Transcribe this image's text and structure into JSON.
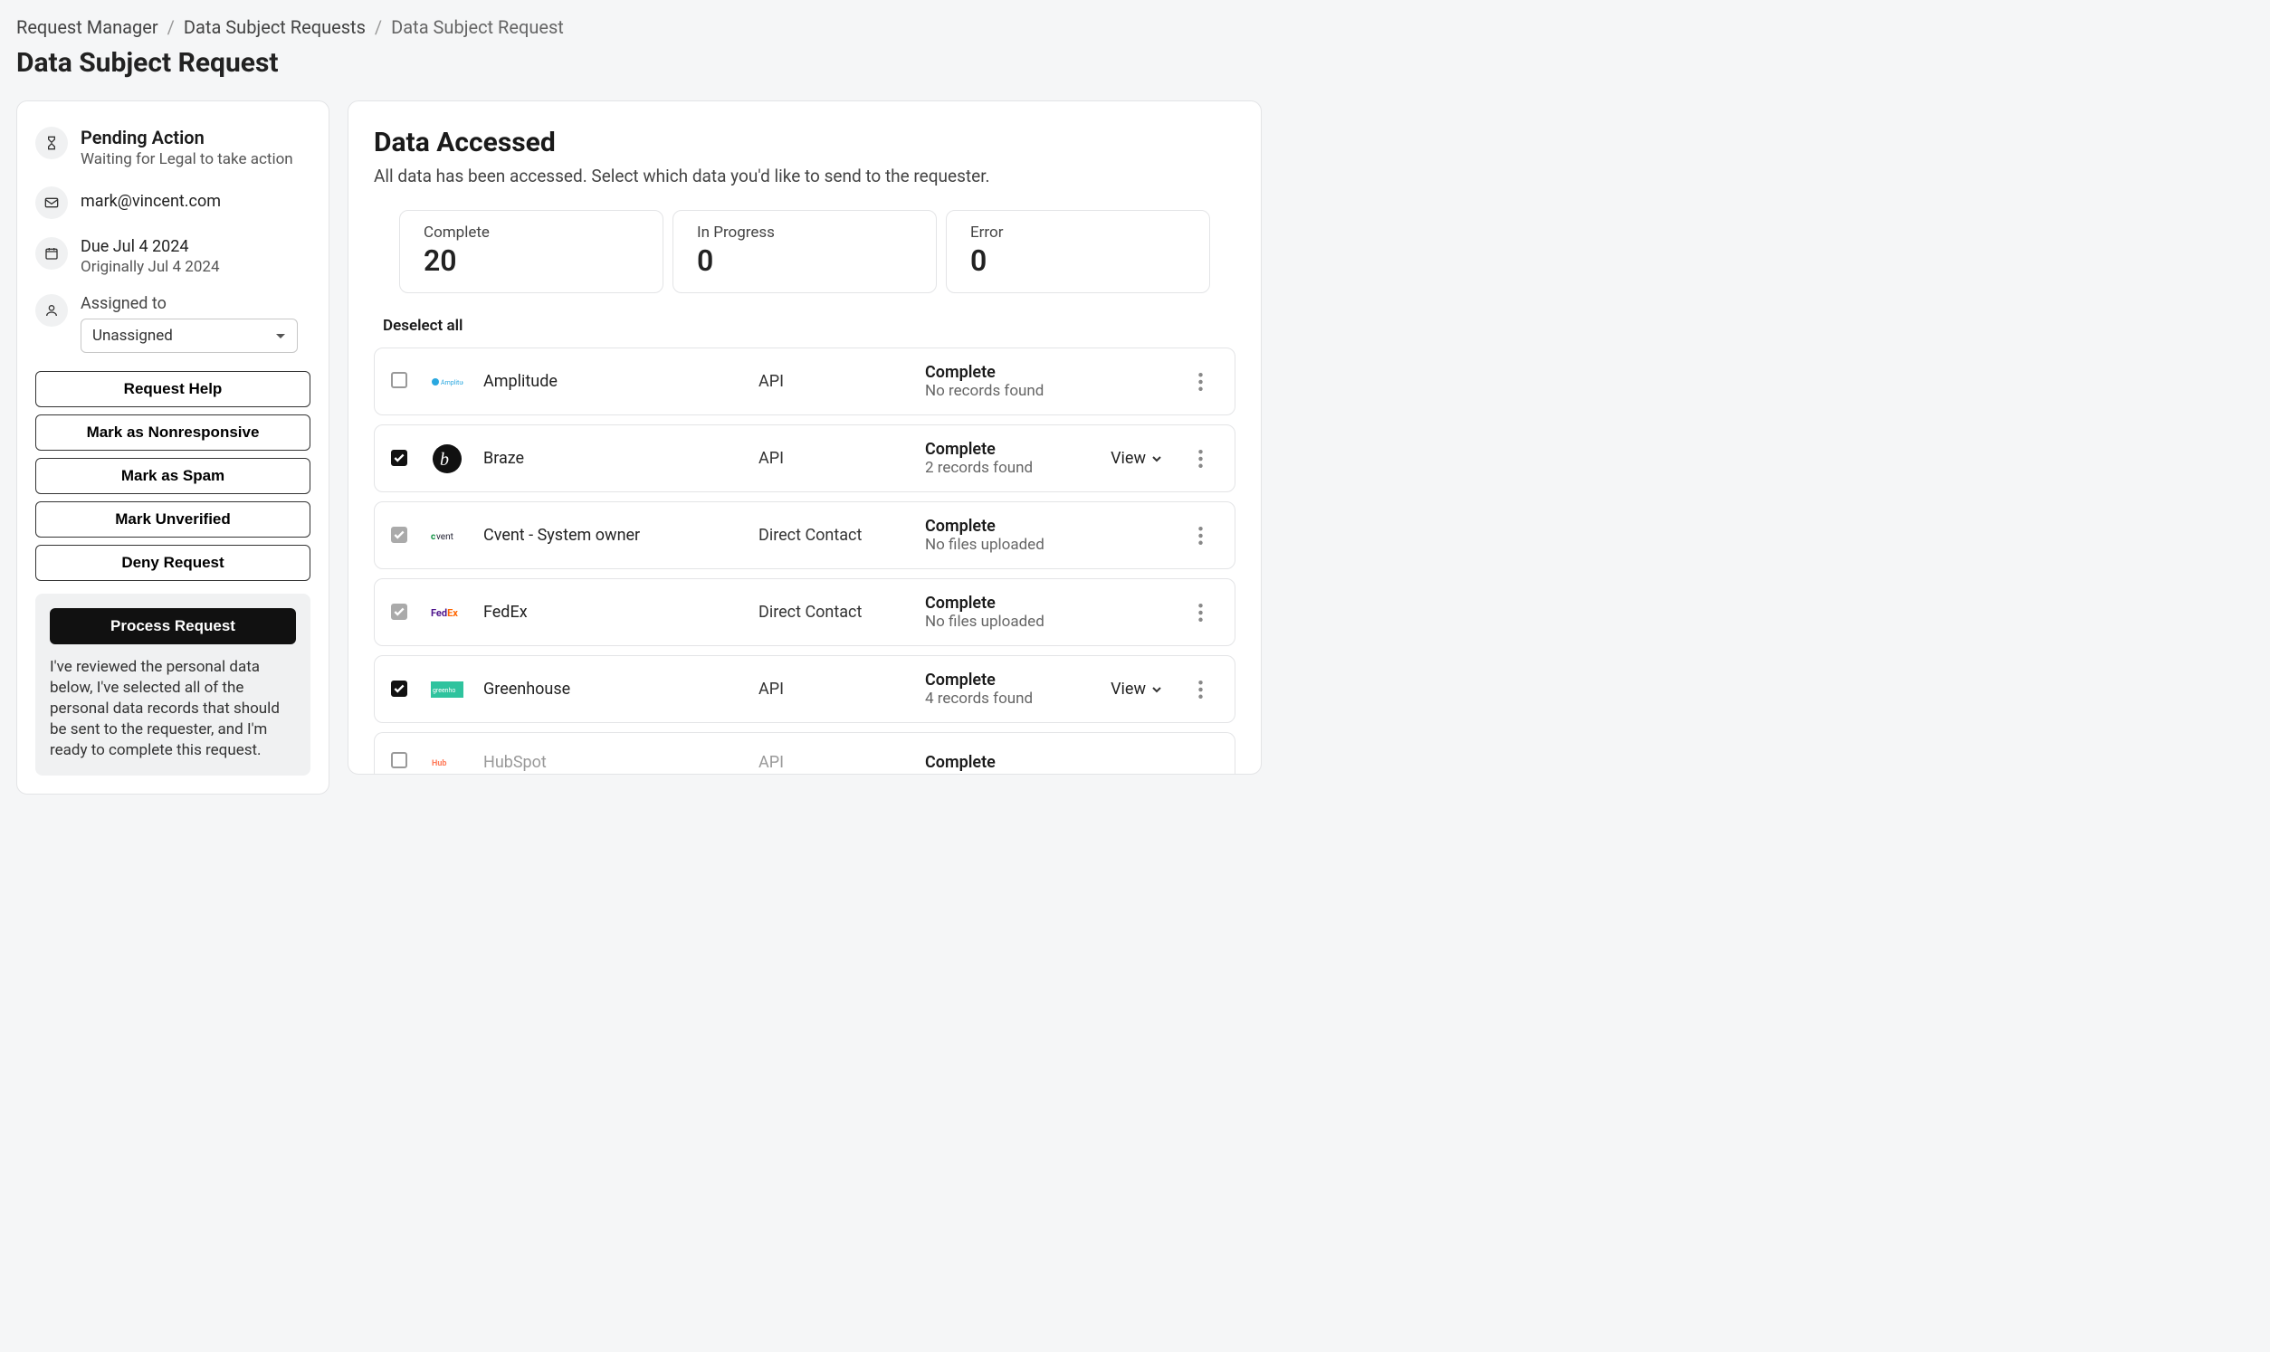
{
  "breadcrumb": [
    "Request Manager",
    "Data Subject Requests",
    "Data Subject Request"
  ],
  "page_title": "Data Subject Request",
  "sidebar": {
    "status_title": "Pending Action",
    "status_sub": "Waiting for Legal to take action",
    "email": "mark@vincent.com",
    "due": "Due Jul 4 2024",
    "original": "Originally Jul 4 2024",
    "assigned_label": "Assigned to",
    "assigned_value": "Unassigned",
    "buttons": {
      "help": "Request Help",
      "nonresponsive": "Mark as Nonresponsive",
      "spam": "Mark as Spam",
      "unverified": "Mark Unverified",
      "deny": "Deny Request"
    },
    "process_btn": "Process Request",
    "process_text": "I've reviewed the personal data below, I've selected all of the personal data records that should be sent to the requester, and I'm ready to complete this request."
  },
  "main": {
    "title": "Data Accessed",
    "subtitle": "All data has been accessed. Select which data you'd like to send to the requester.",
    "stats": {
      "complete_label": "Complete",
      "complete_value": "20",
      "progress_label": "In Progress",
      "progress_value": "0",
      "error_label": "Error",
      "error_value": "0"
    },
    "deselect": "Deselect all",
    "view_label": "View",
    "rows": [
      {
        "name": "Amplitude",
        "method": "API",
        "status": "Complete",
        "detail": "No records found",
        "checked": false,
        "disabled": false,
        "view": false
      },
      {
        "name": "Braze",
        "method": "API",
        "status": "Complete",
        "detail": "2 records found",
        "checked": true,
        "disabled": false,
        "view": true
      },
      {
        "name": "Cvent - System owner",
        "method": "Direct Contact",
        "status": "Complete",
        "detail": "No files uploaded",
        "checked": true,
        "disabled": true,
        "view": false
      },
      {
        "name": "FedEx",
        "method": "Direct Contact",
        "status": "Complete",
        "detail": "No files uploaded",
        "checked": true,
        "disabled": true,
        "view": false
      },
      {
        "name": "Greenhouse",
        "method": "API",
        "status": "Complete",
        "detail": "4 records found",
        "checked": true,
        "disabled": false,
        "view": true
      }
    ],
    "cutoff_row": {
      "name": "HubSpot",
      "method": "API",
      "status": "Complete"
    }
  }
}
